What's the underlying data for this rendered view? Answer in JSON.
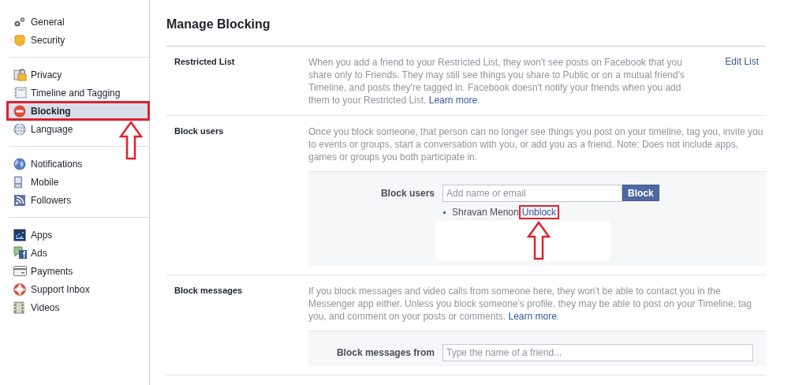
{
  "sidebar": {
    "groups": [
      {
        "items": [
          {
            "label": "General",
            "selected": false,
            "highlighted": false
          },
          {
            "label": "Security",
            "selected": false,
            "highlighted": false
          }
        ]
      },
      {
        "items": [
          {
            "label": "Privacy",
            "selected": false,
            "highlighted": false
          },
          {
            "label": "Timeline and Tagging",
            "selected": false,
            "highlighted": false
          },
          {
            "label": "Blocking",
            "selected": true,
            "highlighted": true
          },
          {
            "label": "Language",
            "selected": false,
            "highlighted": false
          }
        ]
      },
      {
        "items": [
          {
            "label": "Notifications",
            "selected": false,
            "highlighted": false
          },
          {
            "label": "Mobile",
            "selected": false,
            "highlighted": false
          },
          {
            "label": "Followers",
            "selected": false,
            "highlighted": false
          }
        ]
      },
      {
        "items": [
          {
            "label": "Apps",
            "selected": false,
            "highlighted": false
          },
          {
            "label": "Ads",
            "selected": false,
            "highlighted": false
          },
          {
            "label": "Payments",
            "selected": false,
            "highlighted": false
          },
          {
            "label": "Support Inbox",
            "selected": false,
            "highlighted": false
          },
          {
            "label": "Videos",
            "selected": false,
            "highlighted": false
          }
        ]
      }
    ]
  },
  "page": {
    "title": "Manage Blocking"
  },
  "sections": [
    {
      "label": "Restricted List",
      "description": "When you add a friend to your Restricted List, they won't see posts on Facebook that you share only to Friends. They may still see things you share to Public or on a mutual friend's Timeline, and posts they're tagged in. Facebook doesn't notify your friends when you add them to your Restricted List.",
      "link": "Learn more",
      "after": ".",
      "action": "Edit List"
    },
    {
      "label": "Block users",
      "description": "Once you block someone, that person can no longer see things you post on your timeline, tag you, invite you to events or groups, start a conversation with you, or add you as a friend. Note: Does not include apps, games or groups you both participate in.",
      "form": {
        "label": "Block users",
        "placeholder": "Add name or email",
        "button": "Block",
        "blocked": [
          {
            "name": "Shravan Menon",
            "action": "Unblock",
            "highlighted": true
          }
        ]
      }
    },
    {
      "label": "Block messages",
      "description": "If you block messages and video calls from someone here, they won't be able to contact you in the Messenger app either. Unless you block someone's profile, they may be able to post on your Timeline, tag you, and comment on your posts or comments.",
      "link": "Learn more",
      "after": ".",
      "form": {
        "label": "Block messages from",
        "placeholder": "Type the name of a friend..."
      }
    }
  ]
}
